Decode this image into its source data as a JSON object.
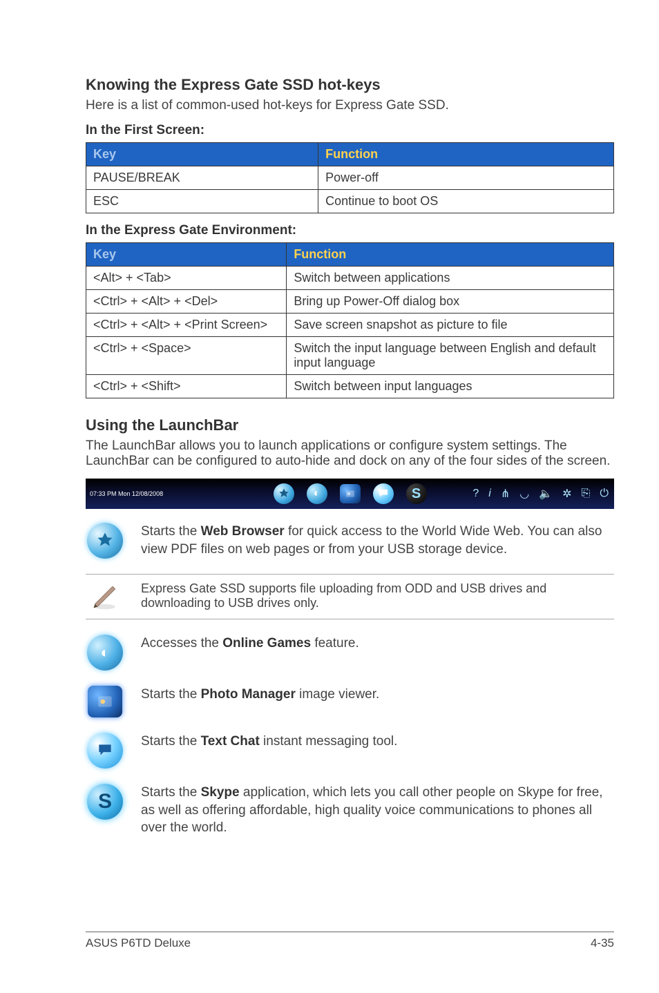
{
  "heading1": "Knowing the Express Gate SSD hot-keys",
  "intro": "Here is a list of common-used hot-keys for Express Gate SSD.",
  "sub1": "In the First Screen:",
  "table1": {
    "headers": [
      "Key",
      "Function"
    ],
    "rows": [
      [
        "PAUSE/BREAK",
        "Power-off"
      ],
      [
        "ESC",
        "Continue to boot OS"
      ]
    ]
  },
  "sub2": "In the Express Gate Environment:",
  "table2": {
    "headers": [
      "Key",
      "Function"
    ],
    "rows": [
      [
        "<Alt> + <Tab>",
        "Switch between applications"
      ],
      [
        "<Ctrl> + <Alt> + <Del>",
        "Bring up Power-Off dialog box"
      ],
      [
        "<Ctrl> + <Alt> + <Print Screen>",
        "Save screen snapshot as picture to file"
      ],
      [
        "<Ctrl> + <Space>",
        "Switch the input language between English and default input language"
      ],
      [
        "<Ctrl> + <Shift>",
        "Switch between input languages"
      ]
    ]
  },
  "heading2": "Using the LaunchBar",
  "launchbar_intro": "The LaunchBar allows you to launch applications or configure system settings. The LaunchBar can be configured to auto-hide and dock on any of the four sides of the screen.",
  "launchbar_time": "07:33  PM Mon 12/08/2008",
  "entries": {
    "web_pre": "Starts the ",
    "web_bold": "Web Browser",
    "web_post": " for quick access to the World Wide Web. You can also view PDF files on web pages or from your USB storage device.",
    "note": "Express Gate SSD supports file uploading from ODD and USB drives and downloading to USB drives only.",
    "games_pre": "Accesses the ",
    "games_bold": "Online Games",
    "games_post": " feature.",
    "photo_pre": "Starts the ",
    "photo_bold": "Photo Manager",
    "photo_post": " image viewer.",
    "chat_pre": "Starts the ",
    "chat_bold": "Text Chat",
    "chat_post": " instant messaging tool.",
    "skype_pre": "Starts the ",
    "skype_bold": "Skype",
    "skype_post": " application, which lets you call other people on Skype for free, as well as offering affordable, high quality voice communications to phones all over the world."
  },
  "footer": {
    "left": "ASUS P6TD Deluxe",
    "right": "4-35"
  }
}
